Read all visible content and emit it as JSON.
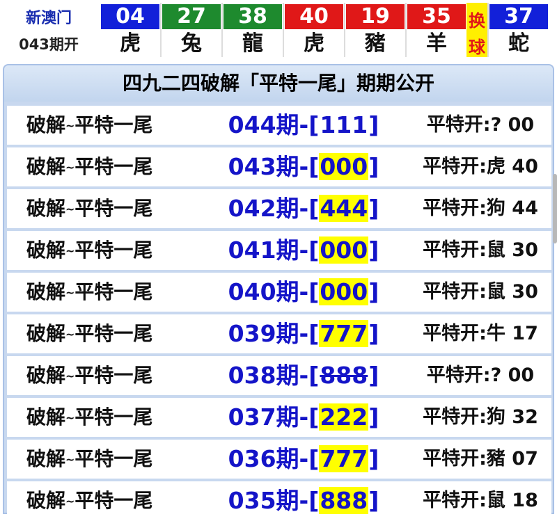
{
  "header": {
    "brand": "新澳门",
    "issue_label": "043期开",
    "balls": [
      {
        "number": "04",
        "zodiac": "虎",
        "color": "#1220d9"
      },
      {
        "number": "27",
        "zodiac": "兔",
        "color": "#1e8a2e"
      },
      {
        "number": "38",
        "zodiac": "龍",
        "color": "#1e8a2e"
      },
      {
        "number": "40",
        "zodiac": "虎",
        "color": "#e01818"
      },
      {
        "number": "19",
        "zodiac": "豬",
        "color": "#e01818"
      },
      {
        "number": "35",
        "zodiac": "羊",
        "color": "#e01818"
      }
    ],
    "switch_label": [
      "换",
      "球"
    ],
    "special": {
      "number": "37",
      "zodiac": "蛇",
      "color": "#1220d9"
    }
  },
  "table": {
    "title": "四九二四破解「平特一尾」期期公开",
    "rows": [
      {
        "label": "破解",
        "tilde": "~",
        "label2": "平特一尾",
        "period": "044期-[",
        "code": "111",
        "close": "]",
        "highlight": false,
        "strike": false,
        "result": "平特开:? 00"
      },
      {
        "label": "破解",
        "tilde": "~",
        "label2": "平特一尾",
        "period": "043期-[",
        "code": "000",
        "close": "]",
        "highlight": true,
        "strike": false,
        "result": "平特开:虎 40"
      },
      {
        "label": "破解",
        "tilde": "~",
        "label2": "平特一尾",
        "period": "042期-[",
        "code": "444",
        "close": "]",
        "highlight": true,
        "strike": false,
        "result": "平特开:狗 44"
      },
      {
        "label": "破解",
        "tilde": "~",
        "label2": "平特一尾",
        "period": "041期-[",
        "code": "000",
        "close": "]",
        "highlight": true,
        "strike": false,
        "result": "平特开:鼠 30"
      },
      {
        "label": "破解",
        "tilde": "~",
        "label2": "平特一尾",
        "period": "040期-[",
        "code": "000",
        "close": "]",
        "highlight": true,
        "strike": false,
        "result": "平特开:鼠 30"
      },
      {
        "label": "破解",
        "tilde": "~",
        "label2": "平特一尾",
        "period": "039期-[",
        "code": "777",
        "close": "]",
        "highlight": true,
        "strike": false,
        "result": "平特开:牛 17"
      },
      {
        "label": "破解",
        "tilde": "~",
        "label2": "平特一尾",
        "period": "038期-[",
        "code": "888",
        "close": "]",
        "highlight": false,
        "strike": true,
        "result": "平特开:? 00"
      },
      {
        "label": "破解",
        "tilde": "~",
        "label2": "平特一尾",
        "period": "037期-[",
        "code": "222",
        "close": "]",
        "highlight": true,
        "strike": false,
        "result": "平特开:狗 32"
      },
      {
        "label": "破解",
        "tilde": "~",
        "label2": "平特一尾",
        "period": "036期-[",
        "code": "777",
        "close": "]",
        "highlight": true,
        "strike": false,
        "result": "平特开:豬 07"
      },
      {
        "label": "破解",
        "tilde": "~",
        "label2": "平特一尾",
        "period": "035期-[",
        "code": "888",
        "close": "]",
        "highlight": true,
        "strike": false,
        "result": "平特开:鼠 18"
      }
    ]
  },
  "colors": {
    "accent_blue": "#1414c8",
    "highlight": "#ffff00",
    "panel_bg": "#c8d8ef"
  }
}
